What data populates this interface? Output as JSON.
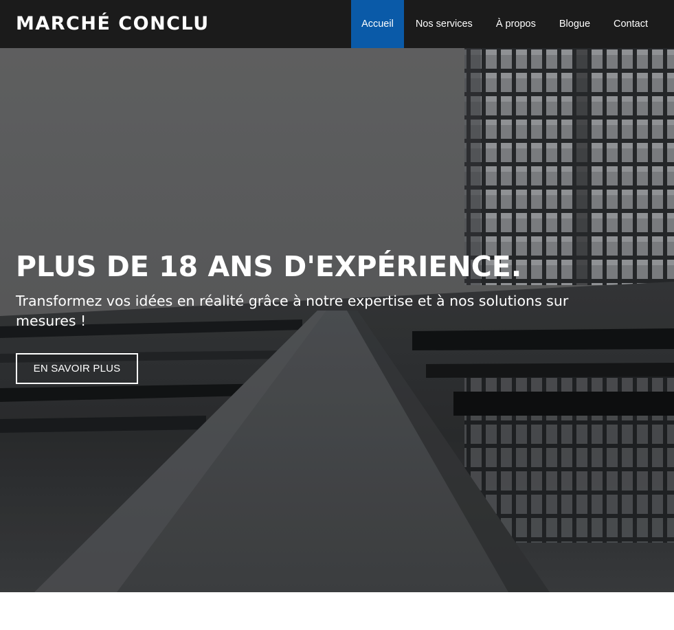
{
  "header": {
    "brand": "MARCHÉ CONCLU",
    "nav": [
      {
        "label": "Accueil",
        "active": true
      },
      {
        "label": "Nos services",
        "active": false
      },
      {
        "label": "À propos",
        "active": false
      },
      {
        "label": "Blogue",
        "active": false
      },
      {
        "label": "Contact",
        "active": false
      }
    ]
  },
  "hero": {
    "title": "PLUS DE 18 ANS D'EXPÉRIENCE.",
    "subtitle": "Transformez vos idées en réalité grâce à notre expertise et à nos solutions sur mesures !",
    "button_label": "EN SAVOIR PLUS",
    "background_image": "grayscale-building-reflection-photo"
  },
  "colors": {
    "header_bg": "#1b1b1b",
    "nav_active_bg": "#0a5aa8",
    "text_on_dark": "#ffffff",
    "hero_sky": "#6a6b6c"
  }
}
